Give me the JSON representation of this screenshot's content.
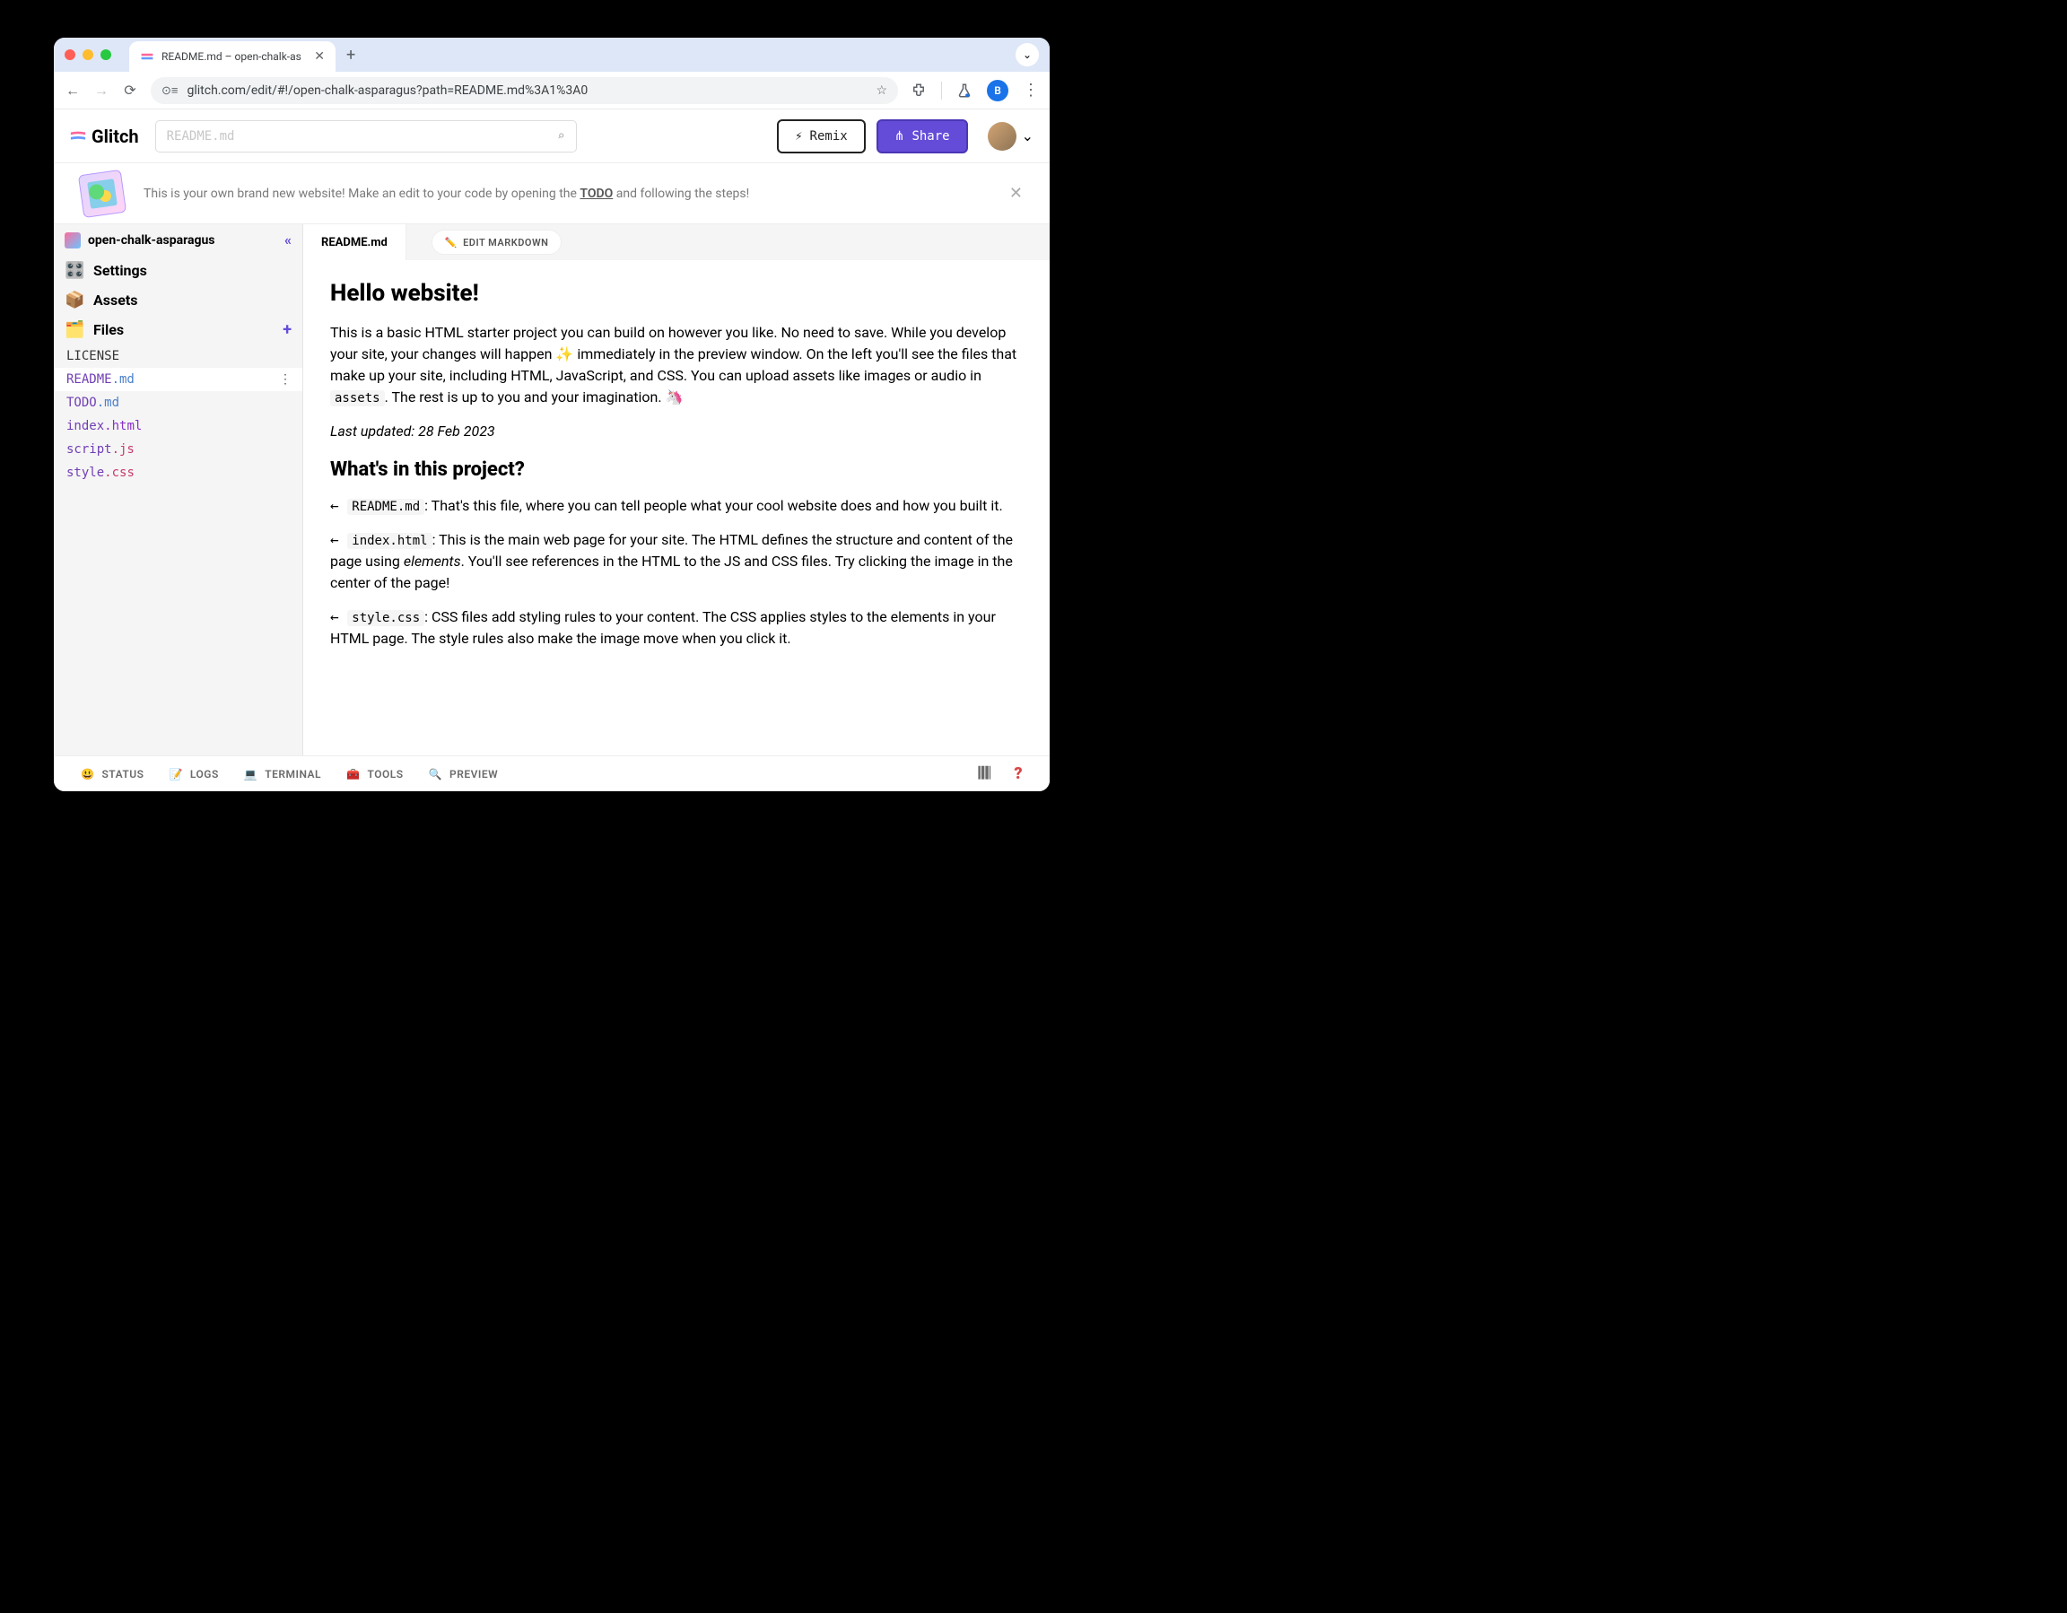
{
  "browser": {
    "tab_title": "README.md – open-chalk-as",
    "url": "glitch.com/edit/#!/open-chalk-asparagus?path=README.md%3A1%3A0",
    "profile_letter": "B"
  },
  "glitch": {
    "logo_text": "Glitch",
    "search_placeholder": "README.md",
    "remix_label": "Remix",
    "share_label": "Share",
    "banner_text_prefix": "This is your own brand new website! Make an edit to your code by opening the ",
    "banner_link": "TODO",
    "banner_text_suffix": " and following the steps!",
    "project_name": "open-chalk-asparagus"
  },
  "sidebar": {
    "settings_label": "Settings",
    "assets_label": "Assets",
    "files_label": "Files",
    "files": [
      {
        "base": "LICENSE",
        "ext": ""
      },
      {
        "base": "README",
        "ext": ".md"
      },
      {
        "base": "TODO",
        "ext": ".md"
      },
      {
        "base": "index",
        "ext": ".html"
      },
      {
        "base": "script",
        "ext": ".js"
      },
      {
        "base": "style",
        "ext": ".css"
      }
    ]
  },
  "editor": {
    "active_tab": "README.md",
    "edit_markdown_label": "EDIT MARKDOWN"
  },
  "readme": {
    "h1": "Hello website!",
    "intro_1": "This is a basic HTML starter project you can build on however you like. No need to save. While you develop your site, your changes will happen ✨ immediately in the preview window. On the left you'll see the files that make up your site, including HTML, JavaScript, and CSS. You can upload assets like images or audio in ",
    "intro_code": "assets",
    "intro_2": ". The rest is up to you and your imagination. 🦄",
    "updated": "Last updated: 28 Feb 2023",
    "h2": "What's in this project?",
    "bullets": [
      {
        "code": "README.md",
        "text": ": That's this file, where you can tell people what your cool website does and how you built it."
      },
      {
        "code": "index.html",
        "text_prefix": ": This is the main web page for your site. The HTML defines the structure and content of the page using ",
        "em": "elements",
        "text_suffix": ". You'll see references in the HTML to the JS and CSS files. Try clicking the image in the center of the page!"
      },
      {
        "code": "style.css",
        "text": ": CSS files add styling rules to your content. The CSS applies styles to the elements in your HTML page. The style rules also make the image move when you click it."
      }
    ]
  },
  "footer": {
    "status": "STATUS",
    "logs": "LOGS",
    "terminal": "TERMINAL",
    "tools": "TOOLS",
    "preview": "PREVIEW"
  }
}
